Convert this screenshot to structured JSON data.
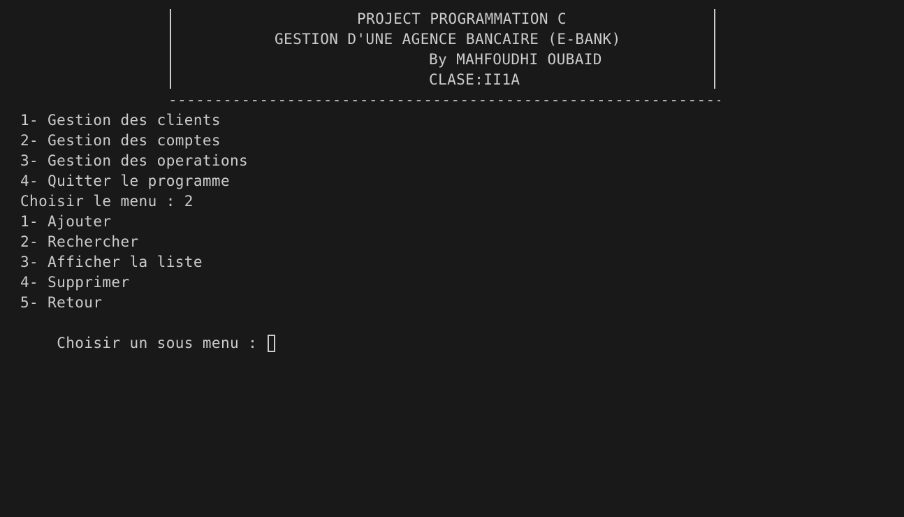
{
  "banner": {
    "title": "PROJECT PROGRAMMATION C",
    "subtitle": "GESTION D'UNE AGENCE BANCAIRE (E-BANK)",
    "author": "By MAHFOUDHI OUBAID",
    "class": "CLASE:II1A",
    "separator": "-------------------------------------------------------------"
  },
  "main_menu": {
    "items": [
      "1- Gestion des clients",
      "2- Gestion des comptes",
      "3- Gestion des operations",
      "4- Quitter le programme"
    ],
    "prompt": "Choisir le menu : 2"
  },
  "sub_menu": {
    "items": [
      "1- Ajouter",
      "2- Rechercher",
      "3- Afficher la liste",
      "4- Supprimer",
      "5- Retour"
    ],
    "prompt": "Choisir un sous menu : "
  },
  "colors": {
    "background": "#191919",
    "foreground": "#cccccc"
  }
}
